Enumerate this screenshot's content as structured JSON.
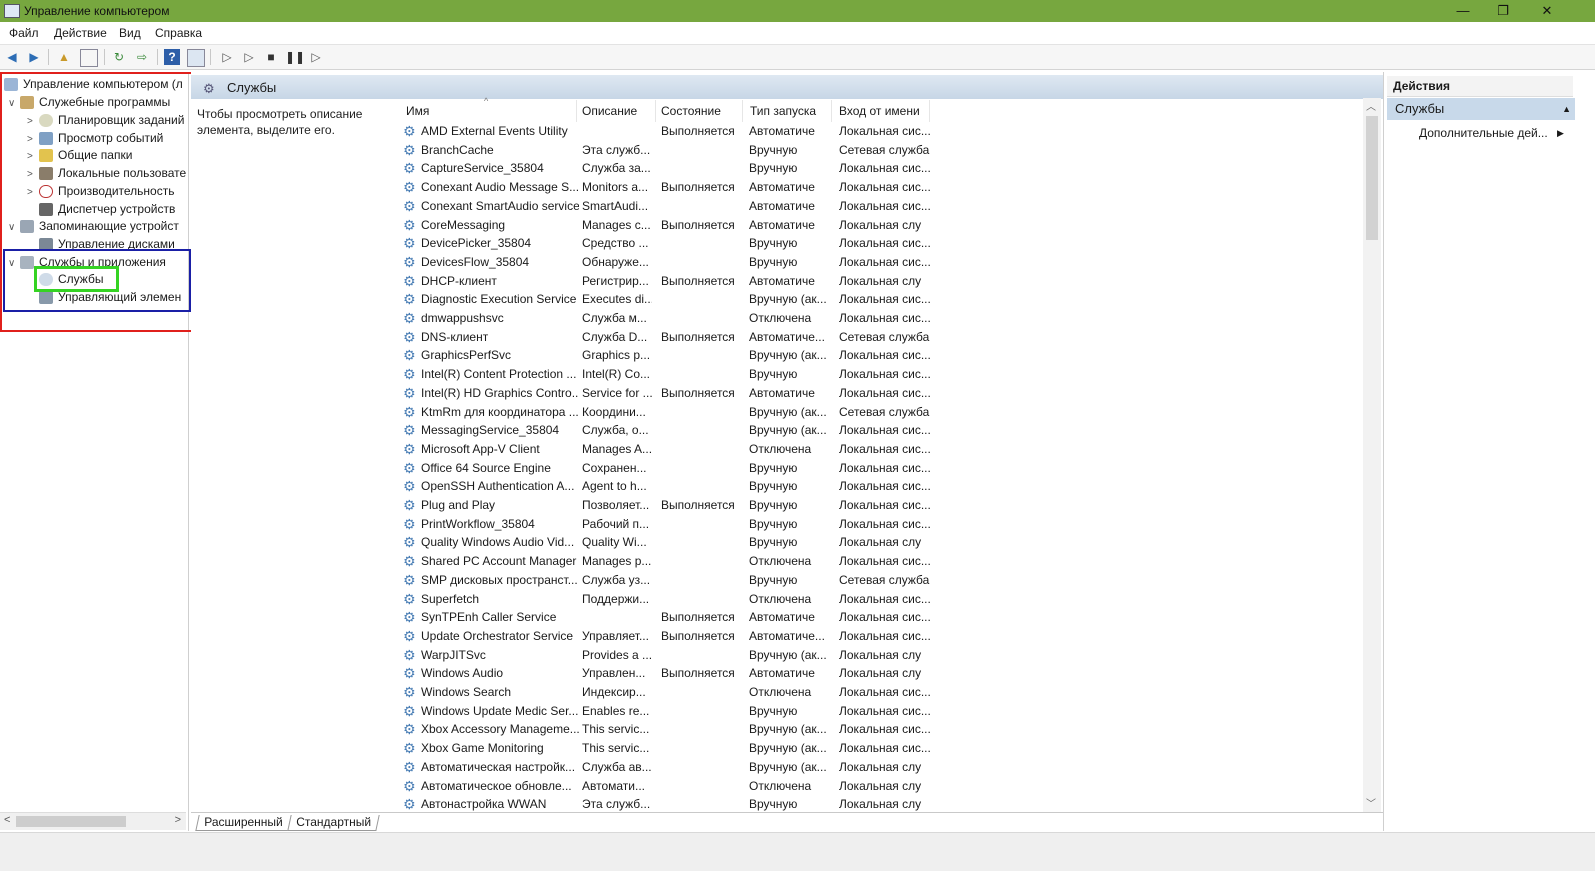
{
  "window": {
    "title": "Управление компьютером",
    "controls": [
      "—",
      "❐",
      "✕"
    ]
  },
  "menu": [
    "Файл",
    "Действие",
    "Вид",
    "Справка"
  ],
  "tree": [
    {
      "label": "Управление компьютером (л",
      "level": 0,
      "arrow": "",
      "icon": "computer-icon"
    },
    {
      "label": "Служебные программы",
      "level": 1,
      "arrow": "∨",
      "icon": "tools-icon"
    },
    {
      "label": "Планировщик заданий",
      "level": 2,
      "arrow": ">",
      "icon": "clock-icon"
    },
    {
      "label": "Просмотр событий",
      "level": 2,
      "arrow": ">",
      "icon": "event-viewer-icon"
    },
    {
      "label": "Общие папки",
      "level": 2,
      "arrow": ">",
      "icon": "shared-folder-icon"
    },
    {
      "label": "Локальные пользовате",
      "level": 2,
      "arrow": ">",
      "icon": "users-icon"
    },
    {
      "label": "Производительность",
      "level": 2,
      "arrow": ">",
      "icon": "performance-icon"
    },
    {
      "label": "Диспетчер устройств",
      "level": 2,
      "arrow": "",
      "icon": "device-manager-icon"
    },
    {
      "label": "Запоминающие устройст",
      "level": 1,
      "arrow": "∨",
      "icon": "storage-icon"
    },
    {
      "label": "Управление дисками",
      "level": 2,
      "arrow": "",
      "icon": "disk-icon"
    },
    {
      "label": "Службы и приложения",
      "level": 1,
      "arrow": "∨",
      "icon": "services-apps-icon"
    },
    {
      "label": "Службы",
      "level": 2,
      "arrow": "",
      "icon": "gear-icon"
    },
    {
      "label": "Управляющий элемен",
      "level": 2,
      "arrow": "",
      "icon": "wmi-icon"
    }
  ],
  "center": {
    "header": "Службы",
    "description": "Чтобы просмотреть описание элемента, выделите его.",
    "columns": [
      "Имя",
      "Описание",
      "Состояние",
      "Тип запуска",
      "Вход от имени"
    ],
    "rows": [
      [
        "AMD External Events Utility",
        "",
        "Выполняется",
        "Автоматиче",
        "Локальная сис..."
      ],
      [
        "BranchCache",
        "Эта служб...",
        "",
        "Вручную",
        "Сетевая служба"
      ],
      [
        "CaptureService_35804",
        "Служба за...",
        "",
        "Вручную",
        "Локальная сис..."
      ],
      [
        "Conexant Audio Message S...",
        "Monitors a...",
        "Выполняется",
        "Автоматиче",
        "Локальная сис..."
      ],
      [
        "Conexant SmartAudio service",
        "SmartAudi...",
        "",
        "Автоматиче",
        "Локальная сис..."
      ],
      [
        "CoreMessaging",
        "Manages c...",
        "Выполняется",
        "Автоматиче",
        "Локальная слу"
      ],
      [
        "DevicePicker_35804",
        "Средство ...",
        "",
        "Вручную",
        "Локальная сис..."
      ],
      [
        "DevicesFlow_35804",
        "Обнаруже...",
        "",
        "Вручную",
        "Локальная сис..."
      ],
      [
        "DHCP-клиент",
        "Регистрир...",
        "Выполняется",
        "Автоматиче",
        "Локальная слу"
      ],
      [
        "Diagnostic Execution Service",
        "Executes di...",
        "",
        "Вручную (ак...",
        "Локальная сис..."
      ],
      [
        "dmwappushsvc",
        "Служба м...",
        "",
        "Отключена",
        "Локальная сис..."
      ],
      [
        "DNS-клиент",
        "Служба D...",
        "Выполняется",
        "Автоматиче...",
        "Сетевая служба"
      ],
      [
        "GraphicsPerfSvc",
        "Graphics p...",
        "",
        "Вручную (ак...",
        "Локальная сис..."
      ],
      [
        "Intel(R) Content Protection ...",
        "Intel(R) Co...",
        "",
        "Вручную",
        "Локальная сис..."
      ],
      [
        "Intel(R) HD Graphics Contro...",
        "Service for ...",
        "Выполняется",
        "Автоматиче",
        "Локальная сис..."
      ],
      [
        "KtmRm для координатора ...",
        "Координи...",
        "",
        "Вручную (ак...",
        "Сетевая служба"
      ],
      [
        "MessagingService_35804",
        "Служба, о...",
        "",
        "Вручную (ак...",
        "Локальная сис..."
      ],
      [
        "Microsoft App-V Client",
        "Manages A...",
        "",
        "Отключена",
        "Локальная сис..."
      ],
      [
        "Office 64 Source Engine",
        "Сохранен...",
        "",
        "Вручную",
        "Локальная сис..."
      ],
      [
        "OpenSSH Authentication A...",
        "Agent to h...",
        "",
        "Вручную",
        "Локальная сис..."
      ],
      [
        "Plug and Play",
        "Позволяет...",
        "Выполняется",
        "Вручную",
        "Локальная сис..."
      ],
      [
        "PrintWorkflow_35804",
        "Рабочий п...",
        "",
        "Вручную",
        "Локальная сис..."
      ],
      [
        "Quality Windows Audio Vid...",
        "Quality Wi...",
        "",
        "Вручную",
        "Локальная слу"
      ],
      [
        "Shared PC Account Manager",
        "Manages p...",
        "",
        "Отключена",
        "Локальная сис..."
      ],
      [
        "SMP дисковых пространст...",
        "Служба уз...",
        "",
        "Вручную",
        "Сетевая служба"
      ],
      [
        "Superfetch",
        "Поддержи...",
        "",
        "Отключена",
        "Локальная сис..."
      ],
      [
        "SynTPEnh Caller Service",
        "",
        "Выполняется",
        "Автоматиче",
        "Локальная сис..."
      ],
      [
        "Update Orchestrator Service",
        "Управляет...",
        "Выполняется",
        "Автоматиче...",
        "Локальная сис..."
      ],
      [
        "WarpJITSvc",
        "Provides a ...",
        "",
        "Вручную (ак...",
        "Локальная слу"
      ],
      [
        "Windows Audio",
        "Управлен...",
        "Выполняется",
        "Автоматиче",
        "Локальная слу"
      ],
      [
        "Windows Search",
        "Индексир...",
        "",
        "Отключена",
        "Локальная сис..."
      ],
      [
        "Windows Update Medic Ser...",
        "Enables re...",
        "",
        "Вручную",
        "Локальная сис..."
      ],
      [
        "Xbox Accessory Manageme...",
        "This servic...",
        "",
        "Вручную (ак...",
        "Локальная сис..."
      ],
      [
        "Xbox Game Monitoring",
        "This servic...",
        "",
        "Вручную (ак...",
        "Локальная сис..."
      ],
      [
        "Автоматическая настройк...",
        "Служба ав...",
        "",
        "Вручную (ак...",
        "Локальная слу"
      ],
      [
        "Автоматическое обновле...",
        "Автомати...",
        "",
        "Отключена",
        "Локальная слу"
      ],
      [
        "Автонастройка WWAN",
        "Эта служб...",
        "",
        "Вручную",
        "Локальная слу"
      ]
    ],
    "tabs": [
      "Расширенный",
      "Стандартный"
    ]
  },
  "actions": {
    "header": "Действия",
    "section": "Службы",
    "item": "Дополнительные дей..."
  },
  "colors": {
    "titlebar": "#77a73f",
    "highlight_red": "#e0201c",
    "highlight_blue": "#1a1fa6",
    "highlight_green": "#35d323"
  }
}
